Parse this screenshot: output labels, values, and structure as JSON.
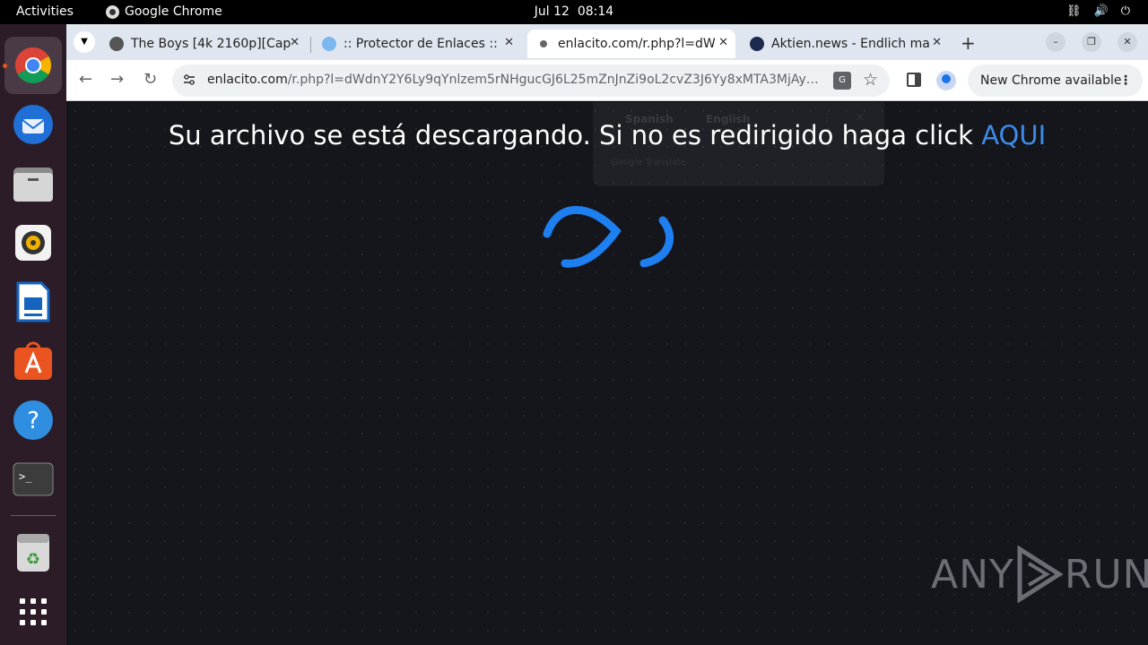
{
  "system_bar": {
    "activities": "Activities",
    "app_name": "Google Chrome",
    "date": "Jul 12",
    "time": "08:14"
  },
  "dock": {
    "apps": [
      "chrome-icon",
      "thunderbird-icon",
      "files-icon",
      "rhythmbox-icon",
      "writer-icon",
      "app-center-icon",
      "help-icon",
      "terminal-icon",
      "trash-icon",
      "app-grid-icon"
    ]
  },
  "tabs": [
    {
      "title": "The Boys [4k 2160p][Cap",
      "active": false
    },
    {
      "title": ":: Protector de Enlaces ::",
      "active": false
    },
    {
      "title": "enlacito.com/r.php?l=dW",
      "active": true
    },
    {
      "title": "Aktien.news - Endlich ma",
      "active": false
    }
  ],
  "omnibox": {
    "host": "enlacito.com",
    "path": "/r.php?l=dWdnY2Y6Ly9qYnlzem5rNHgucGJ6L25mZnJnZi9oL2cvZ3J6Yy8xMTA3MjAyNC8yMjgz..."
  },
  "update_button": "New Chrome available",
  "page": {
    "message": "Su archivo se está descargando. Si no es redirigido haga click ",
    "link": "AQUI"
  },
  "translate_popup": {
    "source_lang": "Spanish",
    "target_lang": "English",
    "brand": "Google Translate"
  },
  "watermark": {
    "left": "ANY",
    "right": "RUN"
  },
  "colors": {
    "accent": "#1a73e8",
    "link": "#3d8be8",
    "loader": "#1e7ff0",
    "page_bg": "#15151c"
  }
}
